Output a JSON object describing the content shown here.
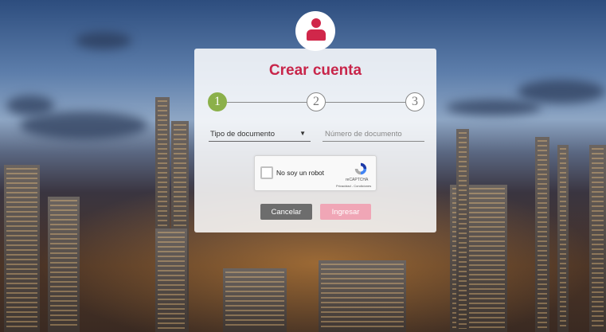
{
  "form": {
    "title": "Crear cuenta",
    "steps": [
      "1",
      "2",
      "3"
    ],
    "active_step": 1,
    "document_type_label": "Tipo de documento",
    "document_number_placeholder": "Número de documento",
    "captcha": {
      "label": "No soy un robot",
      "brand": "reCAPTCHA",
      "links": "Privacidad - Condiciones"
    },
    "cancel_label": "Cancelar",
    "submit_label": "Ingresar"
  },
  "colors": {
    "accent": "#c8254a",
    "step_active": "#8bb04a",
    "cancel_button": "#6d6d6d",
    "submit_button_disabled": "#f0a6b6"
  },
  "icons": {
    "avatar": "user-icon",
    "select": "chevron-down-icon",
    "captcha": "recaptcha-icon"
  }
}
